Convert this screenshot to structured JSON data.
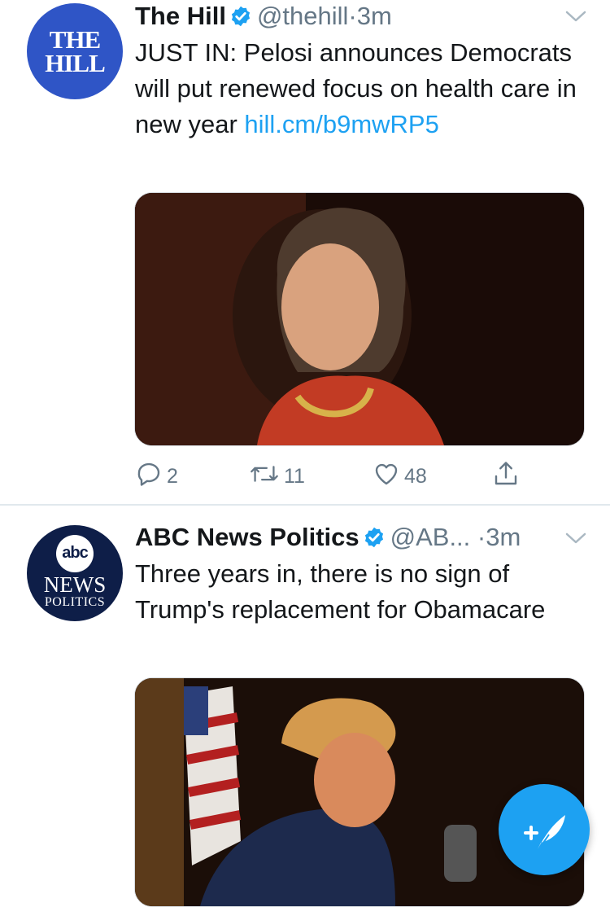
{
  "tweets": [
    {
      "author_name": "The Hill",
      "handle": "@thehill",
      "separator": "·",
      "time": "3m",
      "avatar_text": [
        "THE",
        "HILL"
      ],
      "body": "JUST IN: Pelosi announces Democrats will put renewed focus on health care in new year ",
      "link": "hill.cm/b9mwRP5",
      "media_icon": "portrait-photo",
      "reply_count": "2",
      "retweet_count": "11",
      "like_count": "48"
    },
    {
      "author_name": "ABC News Politics",
      "handle": "@AB...",
      "separator": "·",
      "time": "3m",
      "avatar_text": {
        "logo": "abc",
        "line1": "NEWS",
        "line2": "POLITICS"
      },
      "body": "Three years in, there is no sign of Trump's replacement for Obamacare",
      "media_icon": "portrait-photo"
    }
  ],
  "icons": {
    "verified": "verified-badge-icon",
    "chevron": "chevron-down-icon",
    "reply": "reply-icon",
    "retweet": "retweet-icon",
    "like": "heart-icon",
    "share": "share-icon",
    "compose": "compose-tweet-icon"
  },
  "colors": {
    "accent": "#1da1f2",
    "text": "#14171a",
    "muted": "#657786",
    "hill_blue": "#2f55c6",
    "abc_navy": "#0e1e48"
  }
}
